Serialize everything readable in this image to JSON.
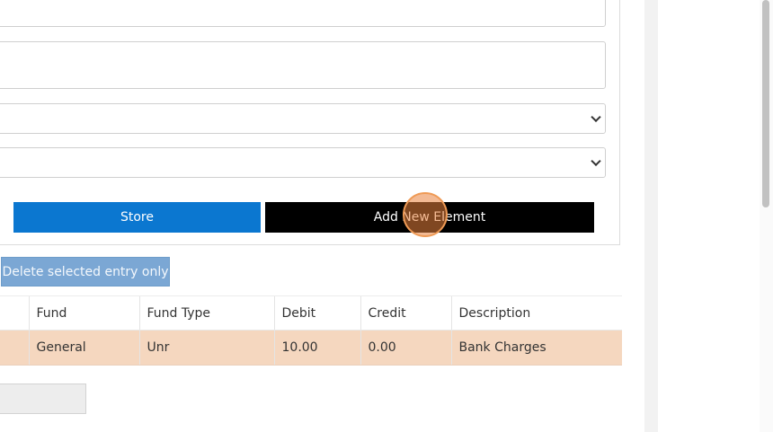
{
  "form": {
    "textarea1_value": "",
    "textarea2_value": "",
    "select1_value": "",
    "select2_value": "",
    "store_label": "Store",
    "add_label": "Add New Element"
  },
  "entries": {
    "delete_label": "Delete selected entry only",
    "columns": [
      "Fund",
      "Fund Type",
      "Debit",
      "Credit",
      "Description"
    ],
    "rows": [
      {
        "fund": "General",
        "fund_type": "Unr",
        "debit": "10.00",
        "credit": "0.00",
        "description": "Bank Charges"
      }
    ]
  },
  "colors": {
    "store_button": "#0b77d0",
    "add_button": "#000000",
    "delete_button": "#7ba7d4",
    "row_highlight": "#f5d7bf",
    "click_indicator": "#ea823c"
  }
}
